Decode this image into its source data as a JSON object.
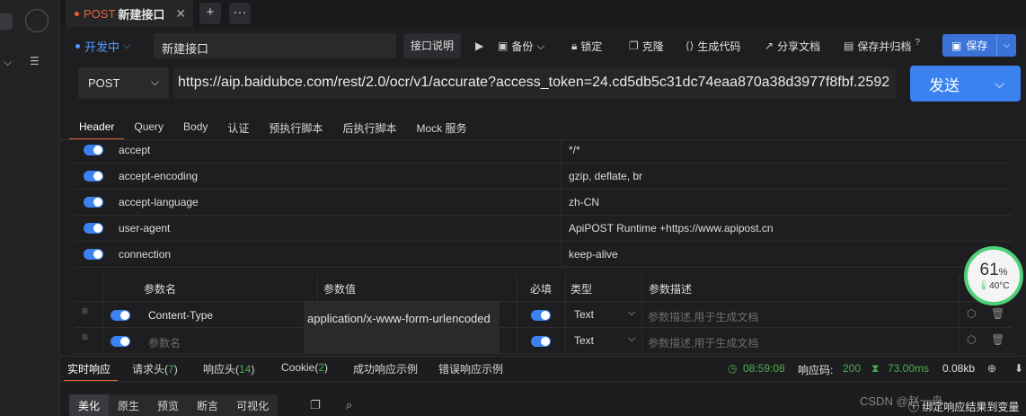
{
  "tab": {
    "method": "POST",
    "name": "新建接口",
    "close": "✕",
    "add": "+",
    "more": "···"
  },
  "env": {
    "label": "开发中",
    "chevron": "⌵"
  },
  "api": {
    "name": "新建接口",
    "doc_label": "接口说明"
  },
  "toolbar": {
    "backup": "备份",
    "lock": "锁定",
    "clone": "克隆",
    "gen_code": "生成代码",
    "share_doc": "分享文档",
    "save_archive": "保存并归档",
    "save": "保存",
    "help": "?"
  },
  "request": {
    "method": "POST",
    "url": "https://aip.baidubce.com/rest/2.0/ocr/v1/accurate?access_token=24.cd5db5c31dc74eaa870a38d3977f8fbf.2592",
    "send_label": "发送"
  },
  "section_tabs": [
    "Header",
    "Query",
    "Body",
    "认证",
    "预执行脚本",
    "后执行脚本",
    "Mock 服务"
  ],
  "headers": [
    {
      "key": "accept",
      "value": "*/*"
    },
    {
      "key": "accept-encoding",
      "value": "gzip, deflate, br"
    },
    {
      "key": "accept-language",
      "value": "zh-CN"
    },
    {
      "key": "user-agent",
      "value": "ApiPOST Runtime +https://www.apipost.cn"
    },
    {
      "key": "connection",
      "value": "keep-alive"
    }
  ],
  "param_table": {
    "columns": [
      "参数名",
      "参数值",
      "必填",
      "类型",
      "参数描述"
    ],
    "rows": [
      {
        "name": "Content-Type",
        "value": "application/x-www-form-urlencoded",
        "type": "Text",
        "desc_placeholder": "参数描述,用于生成文档"
      },
      {
        "name_placeholder": "参数名",
        "type": "Text",
        "desc_placeholder": "参数描述,用于生成文档"
      }
    ]
  },
  "response": {
    "tabs": [
      "实时响应",
      "请求头(",
      "响应头(",
      "Cookie(",
      "成功响应示例",
      "错误响应示例"
    ],
    "counts": [
      "7",
      "14",
      "2"
    ],
    "close_paren": ")",
    "time": "08:59:08",
    "code_label": "响应码:",
    "code": "200",
    "duration": "73.00ms",
    "size": "0.08kb"
  },
  "view_tabs": [
    "美化",
    "原生",
    "预览",
    "断言",
    "可视化"
  ],
  "bind_tip": "绑定响应结果到变量",
  "watermark": "CSDN @赵一舟",
  "gauge": {
    "percent": "61",
    "unit": "%",
    "temp": "40°C"
  },
  "colors": {
    "accent": "#e8613c",
    "primary": "#3b82f0",
    "success": "#4caf50"
  }
}
